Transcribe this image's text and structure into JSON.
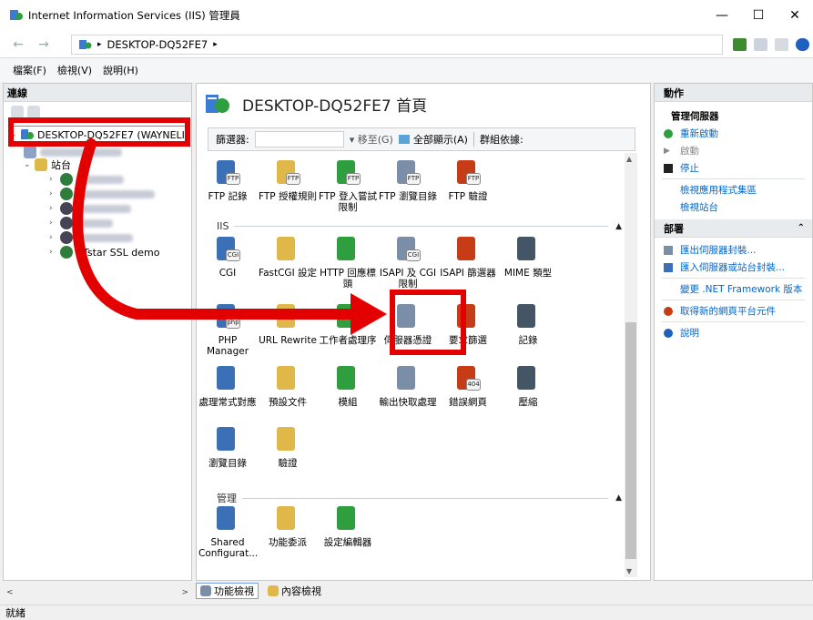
{
  "window": {
    "title": "Internet Information Services (IIS) 管理員",
    "controls": [
      "—",
      "☐",
      "✕"
    ]
  },
  "navigation": {
    "address_crumb": "DESKTOP-DQ52FE7",
    "address_sep": "▸"
  },
  "menu": {
    "items": [
      "檔案(F)",
      "檢視(V)",
      "說明(H)"
    ]
  },
  "connections": {
    "header": "連線",
    "server_label": "DESKTOP-DQ52FE7 (WAYNELI",
    "sites_label": "站台",
    "ssl_site_label": "pTstar SSL demo"
  },
  "center": {
    "page_title": "DESKTOP-DQ52FE7 首頁",
    "filter": {
      "label": "篩選器:",
      "goto": "▾ 移至(G)",
      "show_all": "全部顯示(A)",
      "group_by": "群組依據:"
    },
    "ftp_features": [
      {
        "label": "FTP 記錄",
        "badge": "FTP"
      },
      {
        "label": "FTP 授權規則",
        "badge": "FTP"
      },
      {
        "label": "FTP 登入嘗試限制",
        "badge": "FTP"
      },
      {
        "label": "FTP 瀏覽目錄",
        "badge": "FTP"
      },
      {
        "label": "FTP 驗證",
        "badge": "FTP"
      }
    ],
    "sections": {
      "iis": "IIS",
      "management": "管理"
    },
    "iis_row1": [
      {
        "label": "CGI",
        "badge": "CGI"
      },
      {
        "label": "FastCGI 設定",
        "badge": ""
      },
      {
        "label": "HTTP 回應標頭",
        "badge": ""
      },
      {
        "label": "ISAPI 及 CGI 限制",
        "badge": "CGI"
      },
      {
        "label": "ISAPI 篩選器",
        "badge": ""
      },
      {
        "label": "MIME 類型",
        "badge": ""
      }
    ],
    "iis_row2": [
      {
        "label": "PHP Manager",
        "badge": "php"
      },
      {
        "label": "URL Rewrite",
        "badge": ""
      },
      {
        "label": "工作者處理序",
        "badge": ""
      },
      {
        "label": "伺服器憑證",
        "badge": ""
      },
      {
        "label": "要求篩選",
        "badge": ""
      },
      {
        "label": "記錄",
        "badge": ""
      }
    ],
    "iis_row3": [
      {
        "label": "處理常式對應",
        "badge": ""
      },
      {
        "label": "預設文件",
        "badge": ""
      },
      {
        "label": "模組",
        "badge": ""
      },
      {
        "label": "輸出快取處理",
        "badge": ""
      },
      {
        "label": "錯誤網頁",
        "badge": "404"
      },
      {
        "label": "壓縮",
        "badge": ""
      }
    ],
    "iis_row4": [
      {
        "label": "瀏覽目錄",
        "badge": ""
      },
      {
        "label": "驗證",
        "badge": ""
      }
    ],
    "management_row": [
      {
        "label": "Shared Configurat...",
        "badge": ""
      },
      {
        "label": "功能委派",
        "badge": ""
      },
      {
        "label": "設定編輯器",
        "badge": ""
      }
    ],
    "bottom_tabs": {
      "features_view": "功能檢視",
      "content_view": "內容檢視"
    }
  },
  "actions": {
    "header": "動作",
    "manage_server": "管理伺服器",
    "restart": "重新啟動",
    "start": "啟動",
    "stop": "停止",
    "view_app_pools": "檢視應用程式集區",
    "view_sites": "檢視站台",
    "deploy_header": "部署",
    "export_server_package": "匯出伺服器封裝...",
    "import_server_package": "匯入伺服器或站台封裝...",
    "change_framework": "變更 .NET Framework 版本",
    "get_components": "取得新的網頁平台元件",
    "help": "說明"
  },
  "status": {
    "text": "就緒"
  },
  "colors": {
    "annotation_red": "#e30000",
    "link_blue": "#0066cc",
    "panel_header": "#e8ebee"
  }
}
